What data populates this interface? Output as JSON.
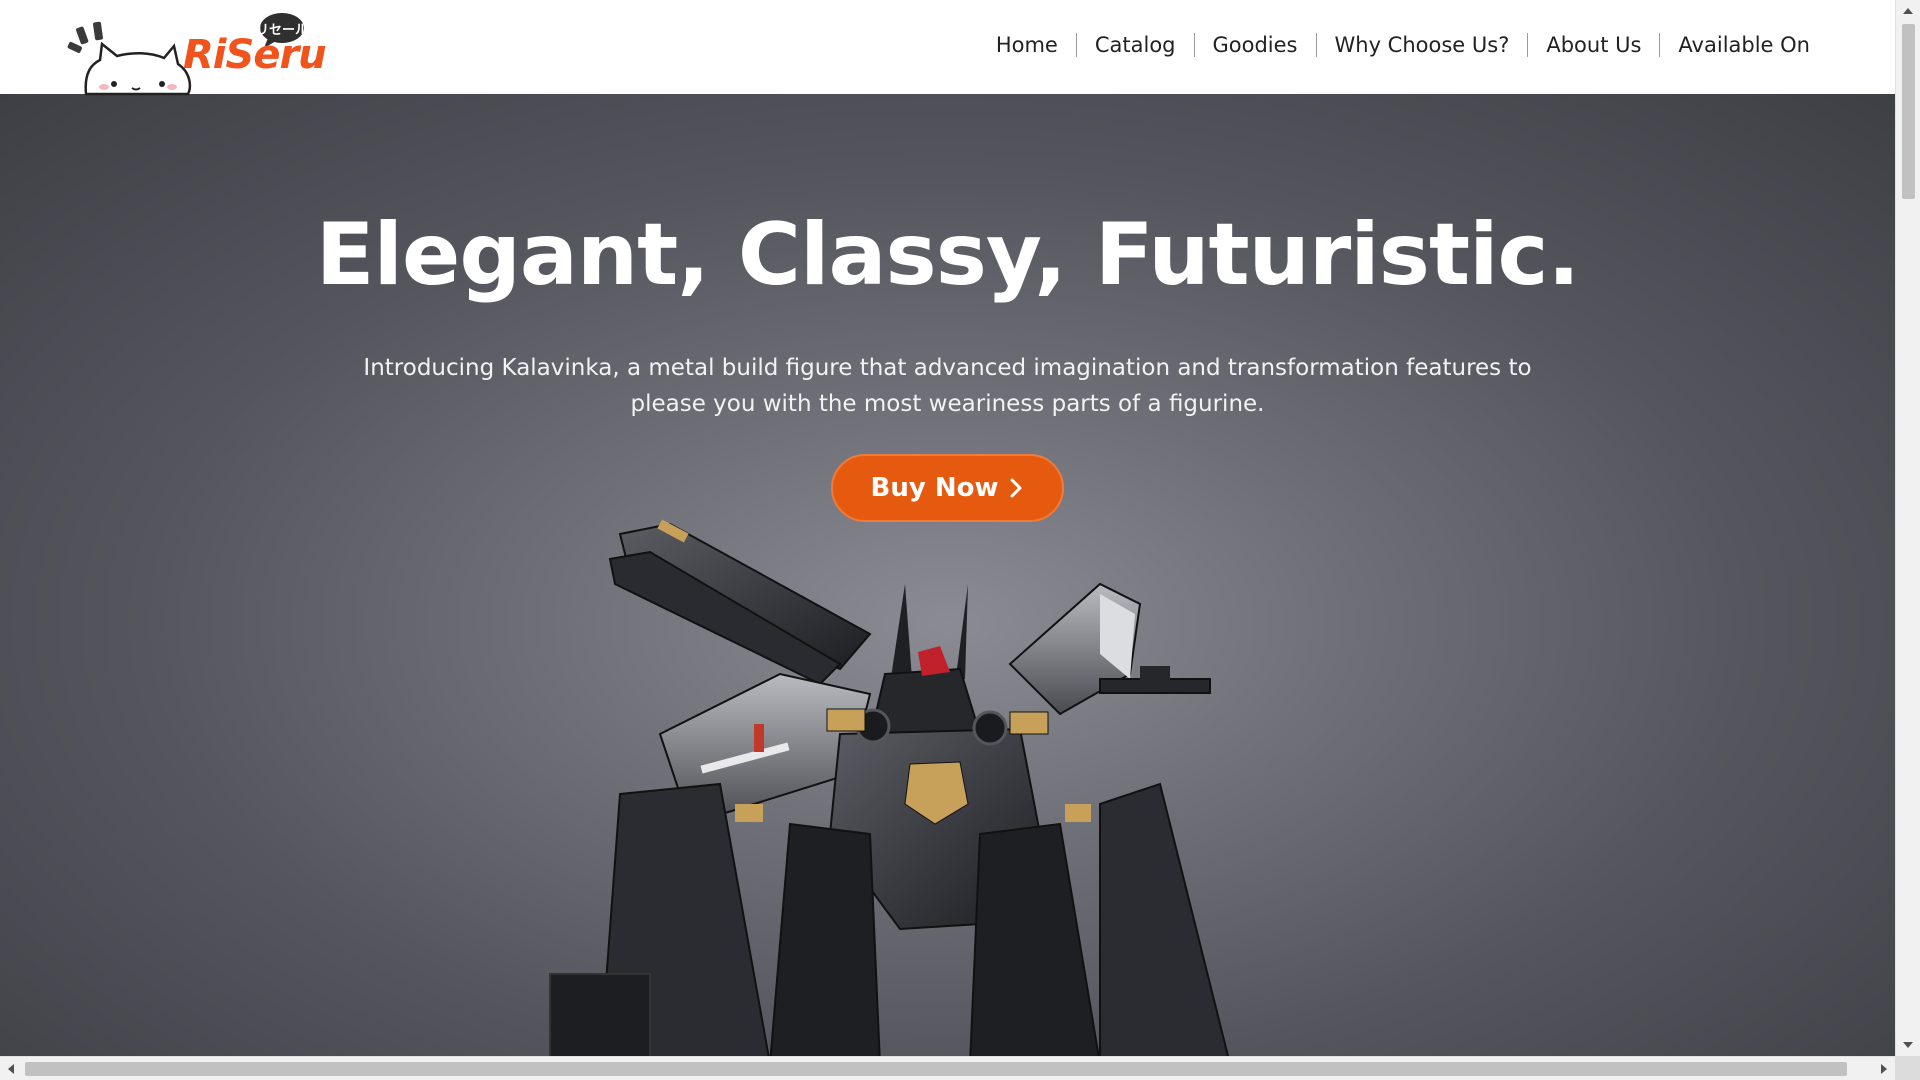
{
  "brand": {
    "logo_text": "RiSeru",
    "logo_badge_text": "リセール",
    "logo_color": "#f0531c"
  },
  "nav": {
    "items": [
      "Home",
      "Catalog",
      "Goodies",
      "Why Choose Us?",
      "About Us",
      "Available On"
    ]
  },
  "hero": {
    "title": "Elegant, Classy, Futuristic.",
    "subtitle_line1": "Introducing Kalavinka, a metal build figure that advanced imagination and transformation features to",
    "subtitle_line2": "please you with the most weariness parts of a figurine.",
    "cta_label": "Buy Now",
    "cta_icon": "chevron-right-icon",
    "cta_color": "#e65a10",
    "background_color": "#5a5b62",
    "image_subject": "robot-figure"
  },
  "scrollbars": {
    "vertical_icon_up": "arrow-up-icon",
    "vertical_icon_down": "arrow-down-icon",
    "horizontal_icon_left": "arrow-left-icon",
    "horizontal_icon_right": "arrow-right-icon"
  }
}
